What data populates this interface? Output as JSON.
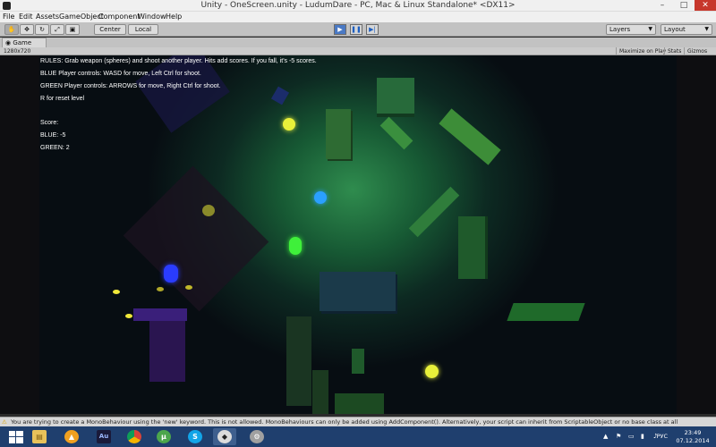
{
  "window": {
    "title": "Unity - OneScreen.unity - LudumDare - PC, Mac & Linux Standalone* <DX11>",
    "minimize": "–",
    "maximize": "□",
    "close": "✕"
  },
  "menu": [
    "File",
    "Edit",
    "Assets",
    "GameObject",
    "Component",
    "Window",
    "Help"
  ],
  "toolbar": {
    "tools": [
      "hand-icon",
      "move-icon",
      "rotate-icon",
      "scale-icon",
      "rect-icon"
    ],
    "pivot_label": "Center",
    "space_label": "Local",
    "play": "▶",
    "pause": "❚❚",
    "step": "▶|",
    "layers_label": "Layers",
    "layout_label": "Layout"
  },
  "game_panel": {
    "tab_label": "Game",
    "resolution": "1280x720",
    "maximize_label": "Maximize on Play",
    "stats_label": "Stats",
    "gizmos_label": "Gizmos"
  },
  "hud": {
    "rules": "RULES: Grab weapon (spheres) and shoot another player. Hits add scores. If you fall, it's -5 scores.",
    "blue_controls": "BLUE Player controls: WASD for move, Left Ctrl for shoot.",
    "green_controls": "GREEN Player controls: ARROWS for move, Right Ctrl for shoot.",
    "reset": "R for reset level",
    "score_label": "Score:",
    "blue_score": "BLUE: -5",
    "green_score": "GREEN: 2"
  },
  "console": {
    "message": "You are trying to create a MonoBehaviour using the 'new' keyword.  This is not allowed.  MonoBehaviours can only be added using AddComponent().  Alternatively, your script can inherit from ScriptableObject or no base class at all"
  },
  "taskbar": {
    "apps": [
      "windows-start-icon",
      "file-explorer-icon",
      "app-orange-icon",
      "after-effects-icon",
      "chrome-icon",
      "utorrent-icon",
      "skype-icon",
      "unity-icon",
      "app-gray-icon"
    ],
    "ae_label": "Au",
    "skype_label": "S",
    "utorrent_label": "µ",
    "language": "РУС",
    "time": "23:49",
    "date": "07.12.2014"
  }
}
